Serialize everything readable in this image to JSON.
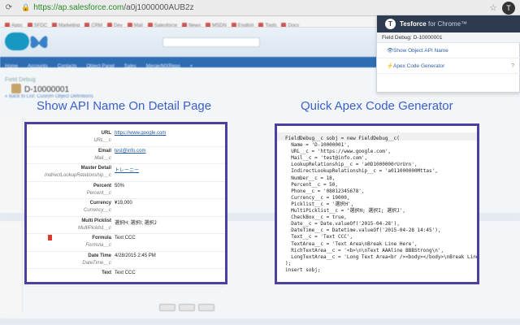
{
  "browser": {
    "url_host": "https://ap.salesforce.com",
    "url_path": "/a0j1000000AUB2z",
    "bookmarks": [
      "Apps",
      "SFDC",
      "Marketing",
      "CRM",
      "Dev",
      "Mail",
      "Salesforce",
      "News",
      "MSDN",
      "English",
      "Tools",
      "Docs"
    ]
  },
  "salesforce": {
    "tabs": [
      "Home",
      "Accounts",
      "Contacts",
      "Object Panel",
      "Sales",
      "Merge/MXRepo",
      "+"
    ],
    "breadcrumb": "Field Debug",
    "record_title": "D-10000001",
    "back_link": "« Back to List: Custom Object Definitions"
  },
  "headings": {
    "left": "Show API Name On Detail Page",
    "right": "Quick Apex Code Generator"
  },
  "detail_fields": [
    {
      "label": "URL",
      "api": "URL__c",
      "value": "https://www.google.com",
      "link": true
    },
    {
      "label": "Email",
      "api": "Mail__c",
      "value": "test@info.com",
      "link": true
    },
    {
      "label": "Master Detail",
      "api": "IndirectLookupRelationship__c",
      "value": "トレーニー",
      "link": true
    },
    {
      "label": "Percent",
      "api": "Percent__c",
      "value": "50%",
      "link": false
    },
    {
      "label": "Currency",
      "api": "Currency__c",
      "value": "¥19,000",
      "link": false
    },
    {
      "label": "Multi Picklist",
      "api": "MultiPicklist__c",
      "value": "選択H; 選択I; 選択J",
      "link": false
    },
    {
      "label": "Formula",
      "api": "Formula__c",
      "value": "Text CCC",
      "link": false
    },
    {
      "label": "Date Time",
      "api": "DateTime__c",
      "value": "4/28/2015 2:45 PM",
      "link": false
    },
    {
      "label": "Text",
      "api": "",
      "value": "Text CCC",
      "link": false
    }
  ],
  "code_lines": [
    "FieldDebug__c sobj = new FieldDebug__c(",
    "  Name = 'D-10000001',",
    "  URL__c = 'https://www.google.com',",
    "  Mail__c = 'test@info.com',",
    "  LookupRelationship__c = 'a0D1000000rUrUrn',",
    "  IndirectLookupRelationship__c = 'a011000000Mttas',",
    "  Number__c = 18,",
    "  Percent__c = 50,",
    "  Phone__c = '08012345678',",
    "  Currency__c = 19000,",
    "  Picklist__c = '選択H',",
    "  MultiPicklist__c = '選択H; 選択I; 選択J',",
    "  CheckBox__c = true,",
    "  Date__c = Date.valueOf('2015-04-28'),",
    "  DateTime__c = Datetime.valueOf('2015-04-28 14:45'),",
    "  Text__c = 'Text CCC',",
    "  TextArea__c = 'Text Area\\nBreak Line Here',",
    "  RichTextArea__c = '<b>\\n\\nText AAAline BBBStrong\\n',",
    "  LongTextArea__c = 'Long Text Area<br /><body></body>\\nBreak Line",
    ");",
    "insert sobj;"
  ],
  "popup": {
    "title": "Tesforce",
    "subtitle": "for Chrome™",
    "record": "Field Debug: D-10000001",
    "items": [
      "Show Object API Name",
      "Apex Code Generator"
    ],
    "help": "?"
  },
  "colors": {
    "heading": "#3a5fcd",
    "panel_border": "#4b3fa0",
    "popup_header": "#2d3a4f",
    "link": "#1f5aa8"
  }
}
